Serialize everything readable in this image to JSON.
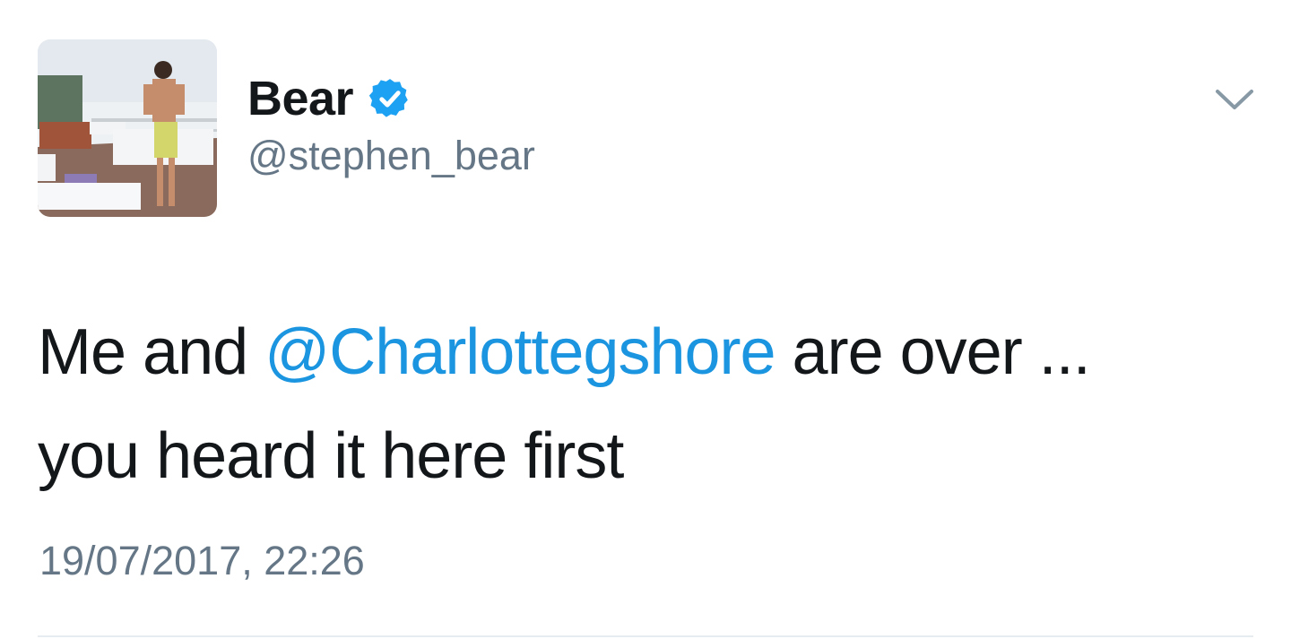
{
  "tweet": {
    "author": {
      "display_name": "Bear",
      "handle": "@stephen_bear",
      "verified": true
    },
    "text": {
      "before_mention": "Me and ",
      "mention": "@Charlottegshore",
      "after_mention": " are over ...",
      "second_line": "you heard it here first"
    },
    "timestamp": "19/07/2017, 22:26"
  },
  "icons": {
    "verified": "verified-badge-icon",
    "menu": "chevron-down-icon"
  },
  "colors": {
    "link": "#1b95e0",
    "verified": "#1da1f2",
    "secondary_text": "#657786",
    "primary_text": "#14171a"
  }
}
